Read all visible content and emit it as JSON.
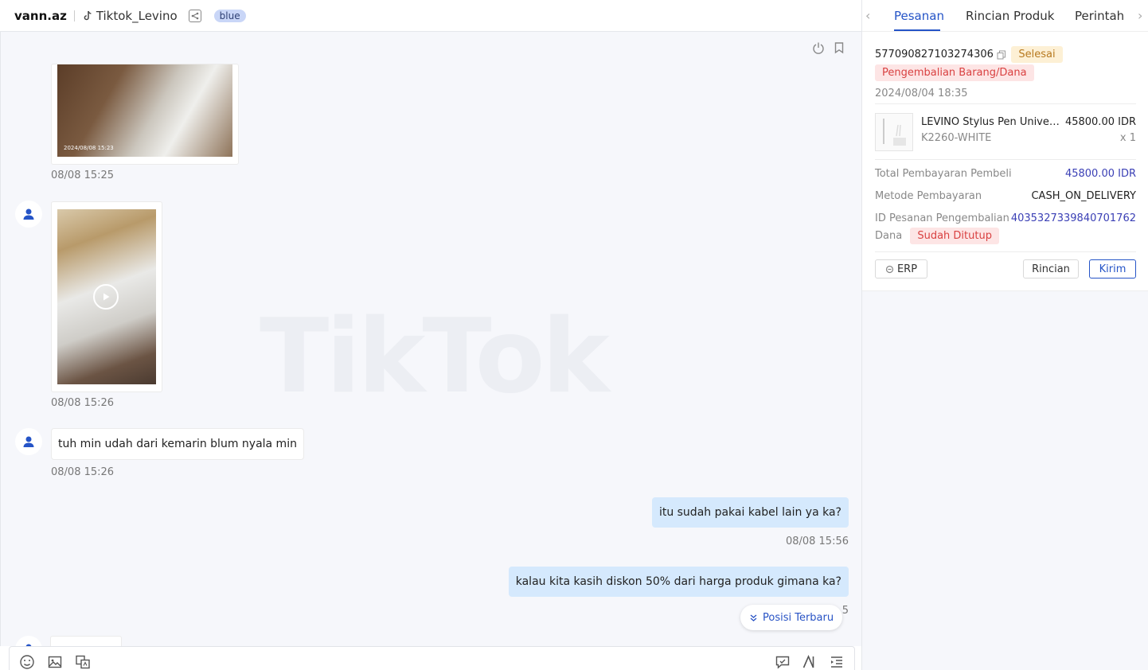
{
  "header": {
    "user": "vann.az",
    "shop": "Tiktok_Levino",
    "tag": "blue"
  },
  "chat": {
    "watermark": "TikTok",
    "messages": [
      {
        "type": "image",
        "photo_caption": "2024/08/08 15:23",
        "time": "08/08 15:25"
      },
      {
        "type": "video",
        "time": "08/08 15:26"
      },
      {
        "type": "text",
        "from": "buyer",
        "text": "tuh min udah dari kemarin blum nyala min",
        "time": "08/08 15:26"
      },
      {
        "type": "text",
        "from": "seller",
        "text": "itu sudah pakai kabel lain ya ka?",
        "time": "08/08 15:56"
      },
      {
        "type": "text",
        "from": "seller",
        "text": "kalau kita kasih diskon 50% dari harga produk gimana ka?",
        "time": "5"
      }
    ],
    "latest_button": "Posisi Terbaru"
  },
  "panel": {
    "tabs": [
      "Pesanan",
      "Rincian Produk",
      "Perintah"
    ],
    "order_id": "577090827103274306",
    "status": "Selesai",
    "return_badge": "Pengembalian Barang/Dana",
    "date": "2024/08/04 18:35",
    "product": {
      "name": "LEVINO Stylus Pen Universal",
      "sku": "K2260-WHITE",
      "price": "45800.00 IDR",
      "qty": "x 1"
    },
    "total_label": "Total Pembayaran Pembeli",
    "total_value": "45800.00 IDR",
    "method_label": "Metode Pembayaran",
    "method_value": "CASH_ON_DELIVERY",
    "refund_label_1": "ID Pesanan Pengembalian",
    "refund_label_2": "Dana",
    "refund_value": "4035327339840701762",
    "refund_status": "Sudah Ditutup",
    "buttons": {
      "erp": "ERP",
      "detail": "Rincian",
      "send": "Kirim"
    }
  },
  "colors": {
    "accent": "#2554c7",
    "seller_bubble": "#d5e9fd",
    "badge_done": "#fdf0d5",
    "badge_red": "#fde5e5"
  }
}
